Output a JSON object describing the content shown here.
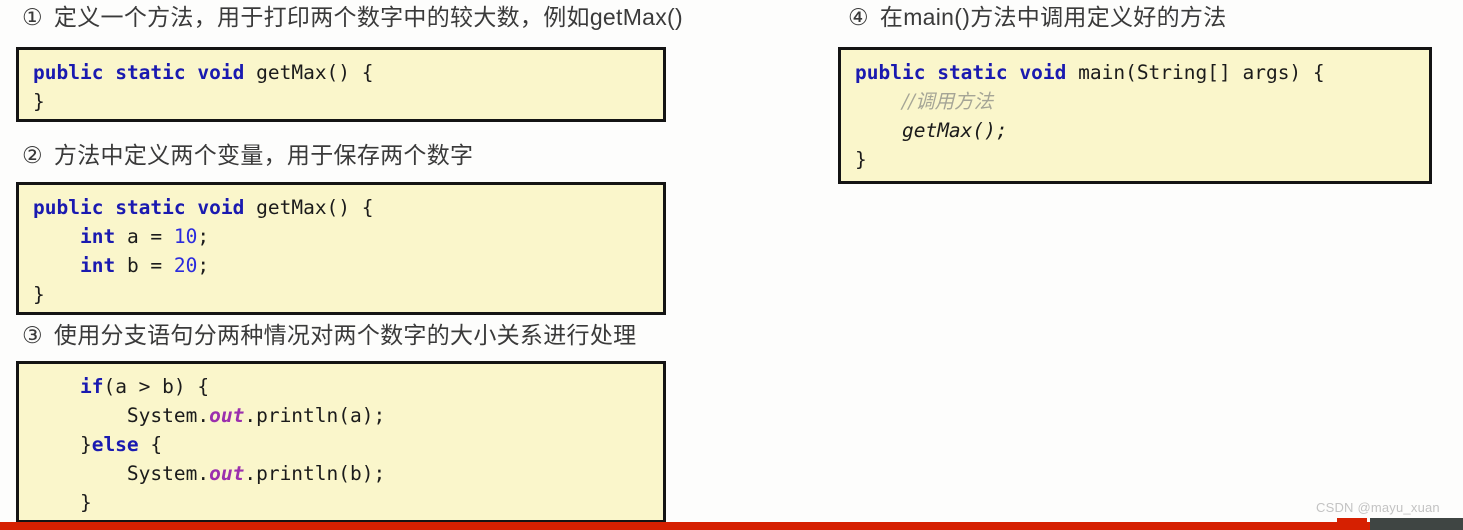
{
  "steps": [
    {
      "marker": "①",
      "heading": "定义一个方法，用于打印两个数字中的较大数，例如getMax()"
    },
    {
      "marker": "②",
      "heading": "方法中定义两个变量，用于保存两个数字"
    },
    {
      "marker": "③",
      "heading": "使用分支语句分两种情况对两个数字的大小关系进行处理"
    },
    {
      "marker": "④",
      "heading": "在main()方法中调用定义好的方法"
    }
  ],
  "code_blocks": {
    "block1": {
      "kw_public": "public",
      "kw_static": "static",
      "kw_void": "void",
      "sig": " getMax() {",
      "close": "}"
    },
    "block2": {
      "kw_public": "public",
      "kw_static": "static",
      "kw_void": "void",
      "sig": " getMax() {",
      "indent": "    ",
      "kw_int_a": "int",
      "decl_a": " a = ",
      "val_a": "10",
      "semi_a": ";",
      "kw_int_b": "int",
      "decl_b": " b = ",
      "val_b": "20",
      "semi_b": ";",
      "close": "}"
    },
    "block3": {
      "indent1": "    ",
      "kw_if": "if",
      "if_cond": "(a > b) {",
      "indent2": "        ",
      "print_a_pre": "System.",
      "print_a_field": "out",
      "print_a_post": ".println(a);",
      "else_pre": "    }",
      "kw_else": "else",
      "else_post": " {",
      "print_b_pre": "System.",
      "print_b_field": "out",
      "print_b_post": ".println(b);",
      "close": "    }"
    },
    "block4": {
      "kw_public": "public",
      "kw_static": "static",
      "kw_void": "void",
      "sig": " main(String[] args) {",
      "comment": "//调用方法",
      "call": "getMax();",
      "close": "}"
    }
  },
  "watermark": "CSDN @mayu_xuan",
  "colors": {
    "code_background": "#faf6cb",
    "code_border": "#141414",
    "keyword": "#1a1ab0",
    "number": "#2b2bdd",
    "field": "#9b2fae",
    "comment": "#a5a596",
    "accent_red": "#d62001",
    "accent_gray": "#3f4543",
    "heading_text": "#3a3a3a"
  }
}
